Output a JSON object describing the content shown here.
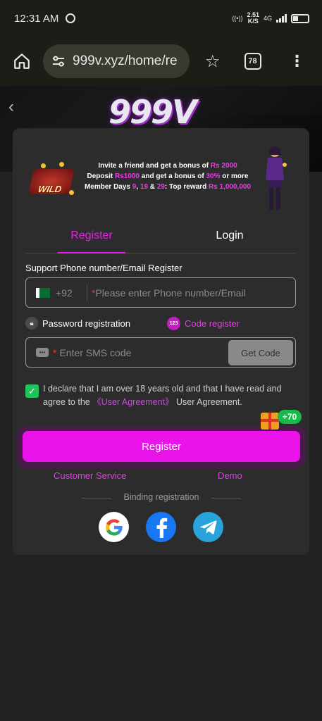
{
  "status_bar": {
    "time": "12:31 AM",
    "speed_value": "2.51",
    "speed_unit": "K/S",
    "network": "4G"
  },
  "browser": {
    "url": "999v.xyz/home/re",
    "tab_count": "78"
  },
  "site": {
    "logo": "999V"
  },
  "banner": {
    "line1_prefix": "Invite a friend and get a bonus of ",
    "line1_amount": "Rs 2000",
    "line2_prefix": "Deposit ",
    "line2_deposit": "Rs1000",
    "line2_mid": " and get a bonus of ",
    "line2_percent": "30%",
    "line2_suffix": " or more",
    "line3_prefix": "Member Days ",
    "line3_day1": "9",
    "line3_sep1": ", ",
    "line3_day2": "19",
    "line3_sep2": " & ",
    "line3_day3": "29",
    "line3_mid": ": Top reward ",
    "line3_amount": "Rs 1,000,000",
    "badge_text": "WILD"
  },
  "tabs": {
    "register": "Register",
    "login": "Login"
  },
  "form": {
    "section_label": "Support Phone number/Email Register",
    "dial_code": "+92",
    "required_mark": "*",
    "phone_placeholder": "Please enter Phone number/Email",
    "password_mode": "Password registration",
    "code_badge": "123",
    "code_mode": "Code register",
    "sms_placeholder": "Enter SMS code",
    "get_code": "Get Code",
    "agree_prefix": "I declare that I am over 18 years old and that I have read and agree to the ",
    "agree_link": "《User Agreement》",
    "agree_suffix": " User Agreement.",
    "bonus": "+70",
    "register_button": "Register"
  },
  "links": {
    "customer_service": "Customer Service",
    "demo": "Demo"
  },
  "binding": {
    "label": "Binding registration"
  },
  "colors": {
    "accent": "#e91ee9",
    "check_green": "#1ec35a",
    "card_bg": "#2c2c2c",
    "page_bg": "#222222"
  }
}
